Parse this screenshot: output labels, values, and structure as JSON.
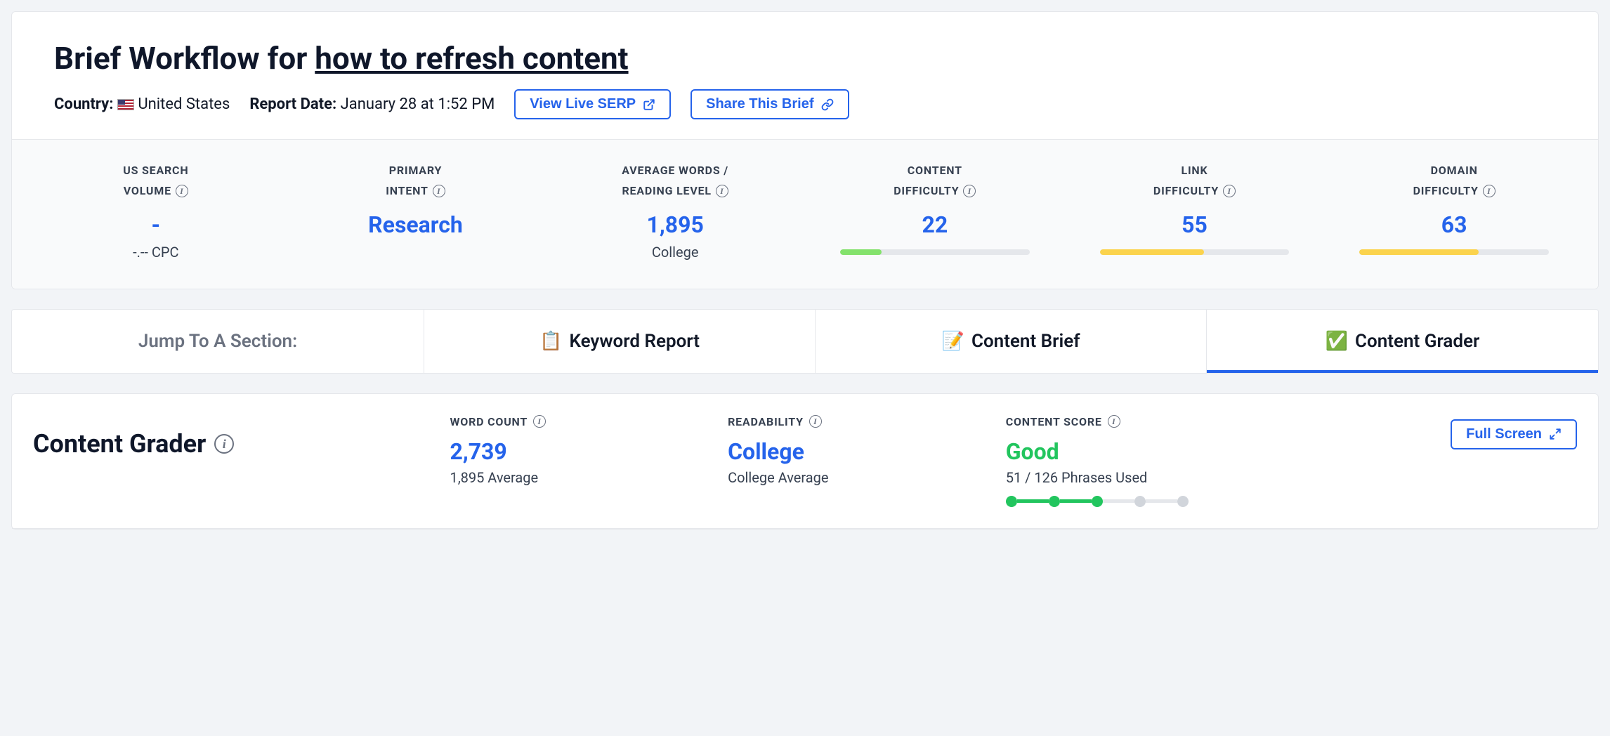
{
  "header": {
    "title_prefix": "Brief Workflow for ",
    "title_keyword": "how to refresh content",
    "country_label": "Country:",
    "country_value": "United States",
    "report_date_label": "Report Date:",
    "report_date_value": "January 28 at 1:52 PM",
    "view_serp_label": "View Live SERP",
    "share_label": "Share This Brief"
  },
  "metrics": {
    "search_volume": {
      "label_line1": "US SEARCH",
      "label_line2": "VOLUME",
      "value": "-",
      "sub": "-.-- CPC"
    },
    "primary_intent": {
      "label_line1": "PRIMARY",
      "label_line2": "INTENT",
      "value": "Research"
    },
    "avg_words": {
      "label_line1": "AVERAGE WORDS /",
      "label_line2": "READING LEVEL",
      "value": "1,895",
      "sub": "College"
    },
    "content_difficulty": {
      "label_line1": "CONTENT",
      "label_line2": "DIFFICULTY",
      "value": "22",
      "fill_pct": 22,
      "fill_color": "green"
    },
    "link_difficulty": {
      "label_line1": "LINK",
      "label_line2": "DIFFICULTY",
      "value": "55",
      "fill_pct": 55,
      "fill_color": "yellow"
    },
    "domain_difficulty": {
      "label_line1": "DOMAIN",
      "label_line2": "DIFFICULTY",
      "value": "63",
      "fill_pct": 63,
      "fill_color": "yellow"
    }
  },
  "tabs": {
    "jump_label": "Jump To A Section:",
    "items": [
      {
        "emoji": "📋",
        "label": "Keyword Report",
        "active": false
      },
      {
        "emoji": "📝",
        "label": "Content Brief",
        "active": false
      },
      {
        "emoji": "✅",
        "label": "Content Grader",
        "active": true
      }
    ]
  },
  "grader": {
    "title": "Content Grader",
    "word_count": {
      "label": "WORD COUNT",
      "value": "2,739",
      "sub": "1,895 Average"
    },
    "readability": {
      "label": "READABILITY",
      "value": "College",
      "sub": "College Average"
    },
    "content_score": {
      "label": "CONTENT SCORE",
      "value": "Good",
      "sub": "51 / 126 Phrases Used",
      "filled_segments": 2,
      "total_segments": 4
    },
    "fullscreen_label": "Full Screen"
  }
}
